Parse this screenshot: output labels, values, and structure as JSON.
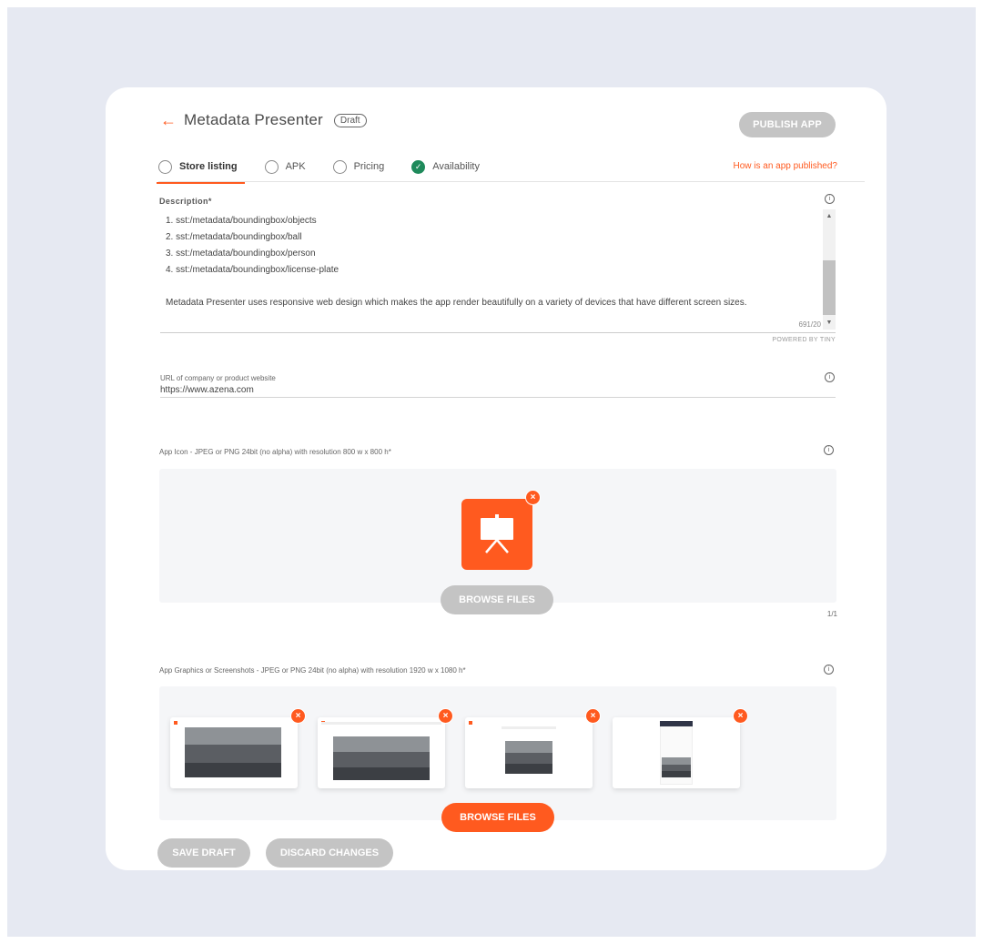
{
  "header": {
    "back_icon": "←",
    "title": "Metadata Presenter",
    "status_badge": "Draft",
    "publish_label": "PUBLISH APP"
  },
  "tabs": [
    {
      "label": "Store listing",
      "checked": false,
      "active": true
    },
    {
      "label": "APK",
      "checked": false,
      "active": false
    },
    {
      "label": "Pricing",
      "checked": false,
      "active": false
    },
    {
      "label": "Availability",
      "checked": true,
      "active": false
    }
  ],
  "help_link": "How is an app published?",
  "description": {
    "label": "Description*",
    "lines": [
      "1. sst:/metadata/boundingbox/objects",
      "2. sst:/metadata/boundingbox/ball",
      "3. sst:/metadata/boundingbox/person",
      "4. sst:/metadata/boundingbox/license-plate"
    ],
    "paragraph": "Metadata Presenter uses responsive web design which makes the app render beautifully on a variety of devices that have different screen sizes.",
    "char_count": "691/20",
    "powered_by": "POWERED BY TINY"
  },
  "website": {
    "label": "URL of company or product website",
    "value": "https://www.azena.com"
  },
  "app_icon": {
    "label": "App Icon - JPEG or PNG 24bit (no alpha) with resolution 800 w x 800 h*",
    "browse_label": "BROWSE FILES",
    "count": "1/1",
    "icon_name": "presentation-board-icon"
  },
  "screenshots": {
    "label": "App Graphics or Screenshots - JPEG or PNG 24bit (no alpha) with resolution 1920 w x 1080 h*",
    "browse_label": "BROWSE FILES",
    "count": 4
  },
  "footer": {
    "save_label": "SAVE DRAFT",
    "discard_label": "DISCARD CHANGES"
  },
  "info_icon": "i",
  "remove_icon": "×",
  "check_icon": "✓",
  "scroll_up_icon": "▲",
  "scroll_down_icon": "▼",
  "colors": {
    "accent": "#ff5a1f",
    "success": "#1f8a5b",
    "disabled_button": "#c4c4c4",
    "page_bg": "#e6e9f2"
  }
}
